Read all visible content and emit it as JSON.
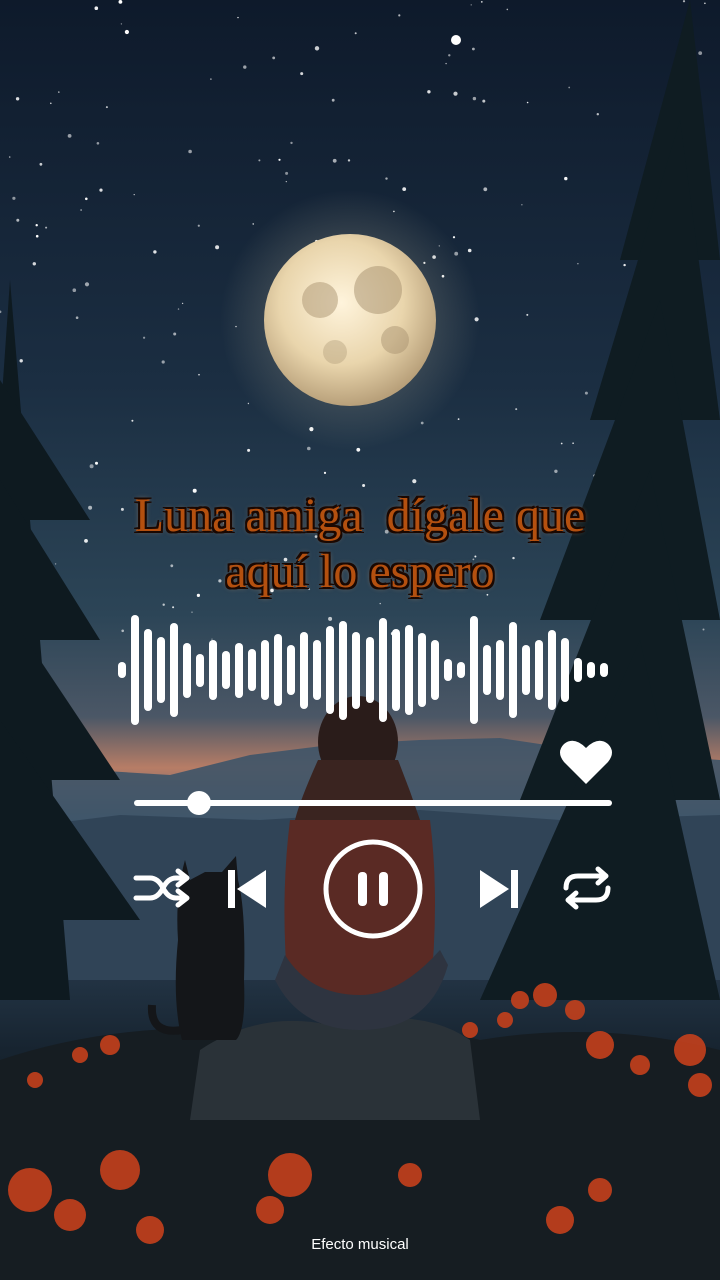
{
  "lyrics": {
    "line1": "Luna amiga  dígale que",
    "line2": "aquí lo espero"
  },
  "player": {
    "progress_fraction": 0.135,
    "liked": true,
    "state": "playing"
  },
  "waveform": {
    "levels": [
      0.15,
      1.0,
      0.75,
      0.6,
      0.85,
      0.5,
      0.3,
      0.55,
      0.35,
      0.5,
      0.38,
      0.55,
      0.65,
      0.45,
      0.7,
      0.55,
      0.8,
      0.9,
      0.7,
      0.6,
      0.95,
      0.75,
      0.82,
      0.68,
      0.55,
      0.2,
      0.15,
      0.98,
      0.45,
      0.55,
      0.88,
      0.45,
      0.55,
      0.72,
      0.58,
      0.22,
      0.15,
      0.12
    ]
  },
  "icons": {
    "like": "heart-icon",
    "shuffle": "shuffle-icon",
    "previous": "skip-previous-icon",
    "play_pause": "pause-icon",
    "next": "skip-next-icon",
    "repeat": "repeat-icon"
  },
  "footer": {
    "credit": "Efecto musical"
  },
  "colors": {
    "lyrics_fill": "#b4500f",
    "lyrics_outline": "#1a0802",
    "controls": "#ffffff"
  }
}
